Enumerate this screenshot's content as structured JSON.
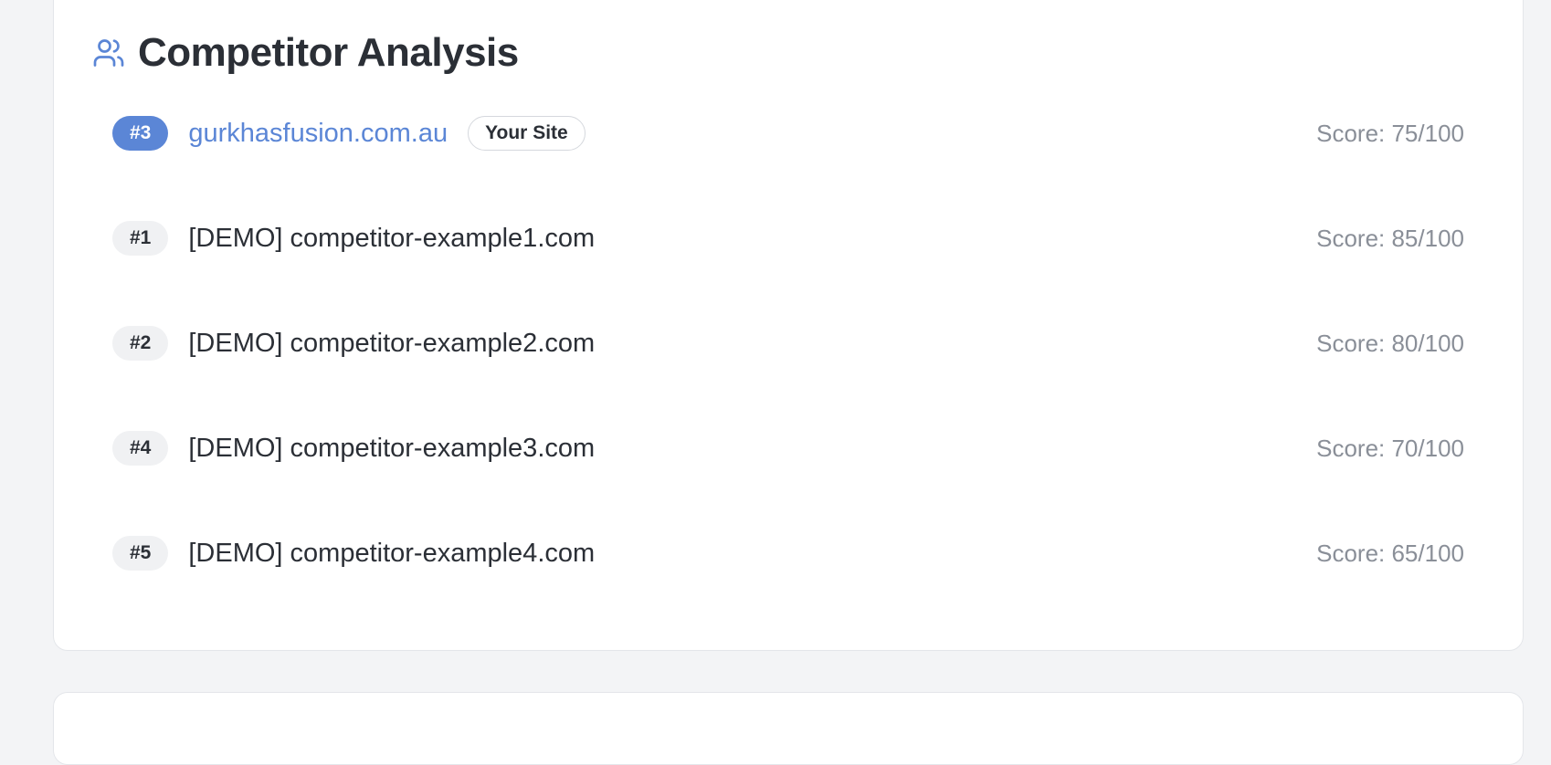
{
  "panel": {
    "title": "Competitor Analysis",
    "icon": "users-icon",
    "accent_color": "#5b86d6"
  },
  "own_site": {
    "rank": "#3",
    "domain": "gurkhasfusion.com.au",
    "tag": "Your Site",
    "score": "Score: 75/100"
  },
  "competitors": [
    {
      "rank": "#1",
      "domain": "[DEMO] competitor-example1.com",
      "score": "Score: 85/100"
    },
    {
      "rank": "#2",
      "domain": "[DEMO] competitor-example2.com",
      "score": "Score: 80/100"
    },
    {
      "rank": "#4",
      "domain": "[DEMO] competitor-example3.com",
      "score": "Score: 70/100"
    },
    {
      "rank": "#5",
      "domain": "[DEMO] competitor-example4.com",
      "score": "Score: 65/100"
    }
  ]
}
